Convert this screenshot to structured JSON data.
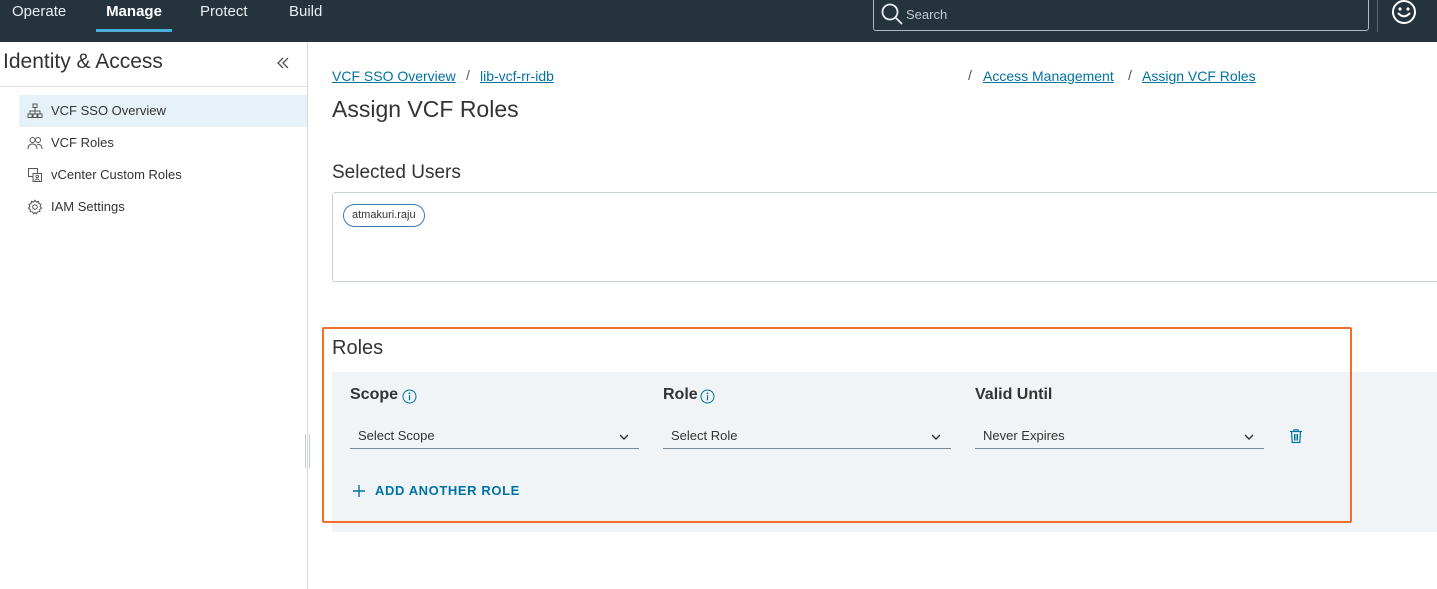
{
  "topnav": {
    "items": [
      {
        "label": "Operate"
      },
      {
        "label": "Manage"
      },
      {
        "label": "Protect"
      },
      {
        "label": "Build"
      }
    ],
    "active": "Manage",
    "search_placeholder": "Search",
    "icons": {
      "search": "search-icon",
      "user": "smiley-user-icon"
    }
  },
  "sidebar": {
    "title": "Identity & Access",
    "collapse_icon": "double-chevron-left-icon",
    "items": [
      {
        "label": "VCF SSO Overview",
        "icon": "sitemap-icon",
        "active": true
      },
      {
        "label": "VCF Roles",
        "icon": "users-icon",
        "active": false
      },
      {
        "label": "vCenter Custom Roles",
        "icon": "custom-roles-icon",
        "active": false
      },
      {
        "label": "IAM Settings",
        "icon": "gear-icon",
        "active": false
      }
    ]
  },
  "breadcrumb": {
    "items": [
      "VCF SSO Overview",
      "lib-vcf-rr-idb",
      "Access Management",
      "Assign VCF Roles"
    ],
    "separator": "/"
  },
  "page": {
    "title": "Assign VCF Roles"
  },
  "selected_users": {
    "title": "Selected Users",
    "users": [
      "atmakuri.raju"
    ]
  },
  "roles": {
    "title": "Roles",
    "columns": {
      "scope": "Scope",
      "role": "Role",
      "valid_until": "Valid Until"
    },
    "row": {
      "scope": "Select Scope",
      "role": "Select Role",
      "valid_until": "Never Expires"
    },
    "add_label": "ADD ANOTHER ROLE",
    "icons": {
      "info": "info-icon",
      "delete": "trash-icon",
      "add": "plus-icon",
      "dropdown": "chevron-down-icon"
    }
  },
  "colors": {
    "topbar": "#25333d",
    "accent": "#0072a3",
    "active_underline": "#49afd9",
    "highlight": "#f0702a",
    "panel": "#f1f4f6"
  }
}
